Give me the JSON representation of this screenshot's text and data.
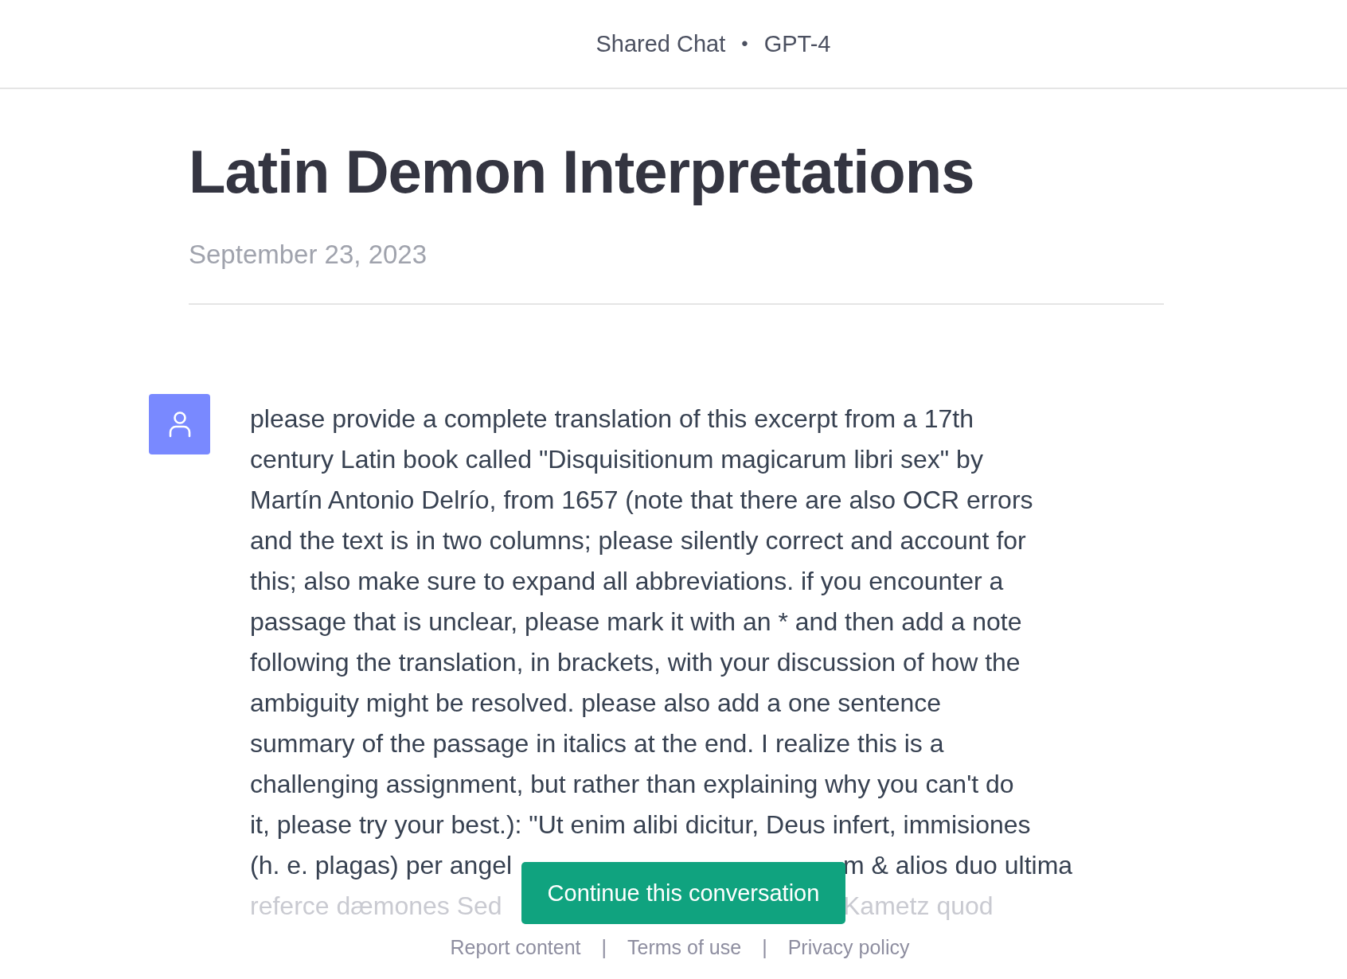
{
  "header": {
    "title": "Shared Chat",
    "separator": "•",
    "model": "GPT-4"
  },
  "conversation": {
    "title": "Latin Demon Interpretations",
    "date": "September 23, 2023"
  },
  "messages": [
    {
      "lines": [
        {
          "kind": "full",
          "text": "please provide a complete translation of this excerpt from a 17th"
        },
        {
          "kind": "full",
          "text": "century Latin book called \"Disquisitionum magicarum libri sex\" by"
        },
        {
          "kind": "full",
          "text": "Martín Antonio Delrío, from 1657 (note that there are also OCR errors"
        },
        {
          "kind": "full",
          "text": "and the text is in two columns; please silently correct and account for"
        },
        {
          "kind": "full",
          "text": "this; also make sure to expand all abbreviations. if you encounter a"
        },
        {
          "kind": "full",
          "text": "passage that is unclear, please mark it with an * and then add a note"
        },
        {
          "kind": "full",
          "text": "following the translation, in brackets, with your discussion of how the"
        },
        {
          "kind": "full",
          "text": "ambiguity might be resolved. please also add a one sentence"
        },
        {
          "kind": "full",
          "text": "summary of the passage in italics at the end. I realize this is a"
        },
        {
          "kind": "full",
          "text": "challenging assignment, but rather than explaining why you can't do"
        },
        {
          "kind": "full",
          "text": "it, please try your best.): \"Ut enim alibi dicitur, Deus infert, immisiones"
        },
        {
          "kind": "split",
          "left": "(h. e. plagas) per angel",
          "right": "m & alios duo ultima"
        },
        {
          "kind": "faded",
          "left": "referce dæmones Sed",
          "right": "Kametz quod"
        }
      ]
    }
  ],
  "continue_button": "Continue this conversation",
  "footer": {
    "links": [
      "Report content",
      "Terms of use",
      "Privacy policy"
    ],
    "separators": [
      "|",
      "|"
    ]
  }
}
